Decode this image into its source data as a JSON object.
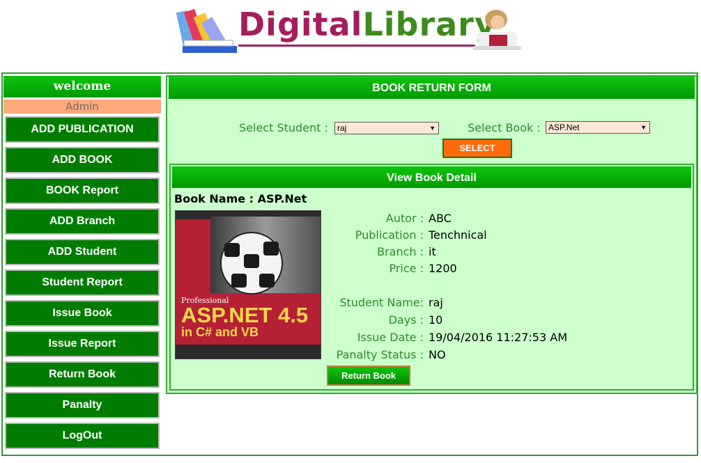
{
  "header": {
    "logo_part1": "Digital",
    "logo_part2": "Library"
  },
  "sidebar": {
    "welcome": "welcome",
    "user": "Admin",
    "items": [
      {
        "label": "ADD PUBLICATION"
      },
      {
        "label": "ADD BOOK"
      },
      {
        "label": "BOOK Report"
      },
      {
        "label": "ADD Branch"
      },
      {
        "label": "ADD Student"
      },
      {
        "label": "Student Report"
      },
      {
        "label": "Issue Book"
      },
      {
        "label": "Issue Report"
      },
      {
        "label": "Return Book"
      },
      {
        "label": "Panalty"
      },
      {
        "label": "LogOut"
      }
    ]
  },
  "form": {
    "title": "BOOK RETURN FORM",
    "student_label": "Select Student :",
    "student_value": "raj",
    "book_label": "Select Book :",
    "book_value": "ASP.Net",
    "select_button": "SELECT"
  },
  "detail": {
    "title": "View Book Detail",
    "book_name_label": "Book Name : ASP.Net",
    "cover_text": {
      "line1": "Professional",
      "line2": "ASP.NET 4.5",
      "line3": "in C# and VB"
    },
    "fields": [
      {
        "label": "Autor :",
        "value": "ABC"
      },
      {
        "label": "Publication :",
        "value": "Tenchnical"
      },
      {
        "label": "Branch :",
        "value": "it"
      },
      {
        "label": "Price :",
        "value": "1200"
      },
      {
        "label": "Student Name:",
        "value": "raj"
      },
      {
        "label": "Days :",
        "value": "10"
      },
      {
        "label": "Issue Date :",
        "value": "19/04/2016 11:27:53 AM"
      },
      {
        "label": "Panalty Status :",
        "value": "NO"
      }
    ],
    "return_button": "Return Book"
  },
  "colors": {
    "green_header": "#0ec40e",
    "nav_button": "#007d00",
    "panel_bg": "#ccffcc",
    "accent_orange": "#ff6a0a",
    "admin_bar": "#fda97a"
  }
}
